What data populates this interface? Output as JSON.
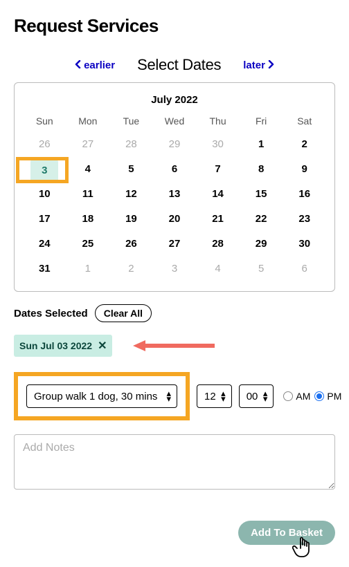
{
  "page_title": "Request Services",
  "nav": {
    "earlier": "earlier",
    "later": "later",
    "select_dates": "Select Dates"
  },
  "calendar": {
    "month_label": "July 2022",
    "dow": [
      "Sun",
      "Mon",
      "Tue",
      "Wed",
      "Thu",
      "Fri",
      "Sat"
    ],
    "cells": [
      {
        "d": "26",
        "out": true
      },
      {
        "d": "27",
        "out": true
      },
      {
        "d": "28",
        "out": true
      },
      {
        "d": "29",
        "out": true
      },
      {
        "d": "30",
        "out": true
      },
      {
        "d": "1",
        "out": false
      },
      {
        "d": "2",
        "out": false
      },
      {
        "d": "3",
        "out": false,
        "selected": true
      },
      {
        "d": "4",
        "out": false
      },
      {
        "d": "5",
        "out": false
      },
      {
        "d": "6",
        "out": false
      },
      {
        "d": "7",
        "out": false
      },
      {
        "d": "8",
        "out": false
      },
      {
        "d": "9",
        "out": false
      },
      {
        "d": "10",
        "out": false
      },
      {
        "d": "11",
        "out": false
      },
      {
        "d": "12",
        "out": false
      },
      {
        "d": "13",
        "out": false
      },
      {
        "d": "14",
        "out": false
      },
      {
        "d": "15",
        "out": false
      },
      {
        "d": "16",
        "out": false
      },
      {
        "d": "17",
        "out": false
      },
      {
        "d": "18",
        "out": false
      },
      {
        "d": "19",
        "out": false
      },
      {
        "d": "20",
        "out": false
      },
      {
        "d": "21",
        "out": false
      },
      {
        "d": "22",
        "out": false
      },
      {
        "d": "23",
        "out": false
      },
      {
        "d": "24",
        "out": false
      },
      {
        "d": "25",
        "out": false
      },
      {
        "d": "26",
        "out": false
      },
      {
        "d": "27",
        "out": false
      },
      {
        "d": "28",
        "out": false
      },
      {
        "d": "29",
        "out": false
      },
      {
        "d": "30",
        "out": false
      },
      {
        "d": "31",
        "out": false
      },
      {
        "d": "1",
        "out": true
      },
      {
        "d": "2",
        "out": true
      },
      {
        "d": "3",
        "out": true
      },
      {
        "d": "4",
        "out": true
      },
      {
        "d": "5",
        "out": true
      },
      {
        "d": "6",
        "out": true
      }
    ]
  },
  "dates_selected": {
    "label": "Dates Selected",
    "clear_all": "Clear All",
    "chips": [
      {
        "text": "Sun Jul 03 2022"
      }
    ]
  },
  "service": {
    "value": "Group walk 1 dog, 30 mins",
    "hour": "12",
    "minute": "00",
    "am_label": "AM",
    "pm_label": "PM",
    "ampm_selected": "PM"
  },
  "notes_placeholder": "Add Notes",
  "basket_label": "Add To Basket",
  "annotations": {
    "arrow_color": "#f06a5f",
    "highlight_color": "#f5a623"
  }
}
